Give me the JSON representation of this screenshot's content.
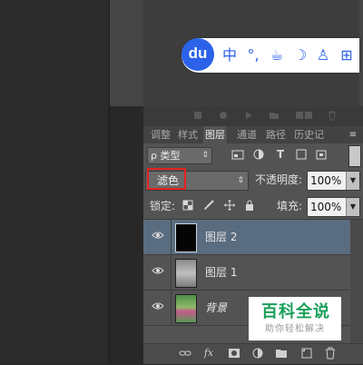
{
  "ime": {
    "logo": "du",
    "items": [
      {
        "label": "中",
        "icon": "chinese-mode"
      },
      {
        "label": "°,",
        "icon": "punctuation"
      },
      {
        "label": "☕",
        "icon": "cup-icon"
      },
      {
        "label": "☽",
        "icon": "moon-icon"
      },
      {
        "label": "♙",
        "icon": "user-icon"
      },
      {
        "label": "⊞",
        "icon": "grid-icon"
      }
    ]
  },
  "panel": {
    "tabs": [
      "调整",
      "样式",
      "图层",
      "通道",
      "路径",
      "历史记"
    ],
    "active_tab": "图层",
    "menu_glyph": "≡",
    "filter": {
      "label": "ρ 类型",
      "arrow": "⇕"
    },
    "blend_mode": {
      "value": "滤色",
      "arrow": "⇕"
    },
    "opacity": {
      "label": "不透明度:",
      "value": "100%"
    },
    "lock": {
      "label": "锁定:"
    },
    "fill": {
      "label": "填充:",
      "value": "100%"
    }
  },
  "layers": [
    {
      "name": "图层 2",
      "selected": true,
      "thumb": "black"
    },
    {
      "name": "图层 1",
      "selected": false,
      "thumb": "gray"
    },
    {
      "name": "背景",
      "selected": false,
      "thumb": "color"
    }
  ],
  "watermark": {
    "title": "百科全说",
    "subtitle": "助你轻松解决"
  },
  "colors": {
    "ime_blue": "#2b62e8",
    "highlight_red": "#e32222",
    "selected_layer": "#5a6c80",
    "watermark_green": "#1aa05a"
  }
}
